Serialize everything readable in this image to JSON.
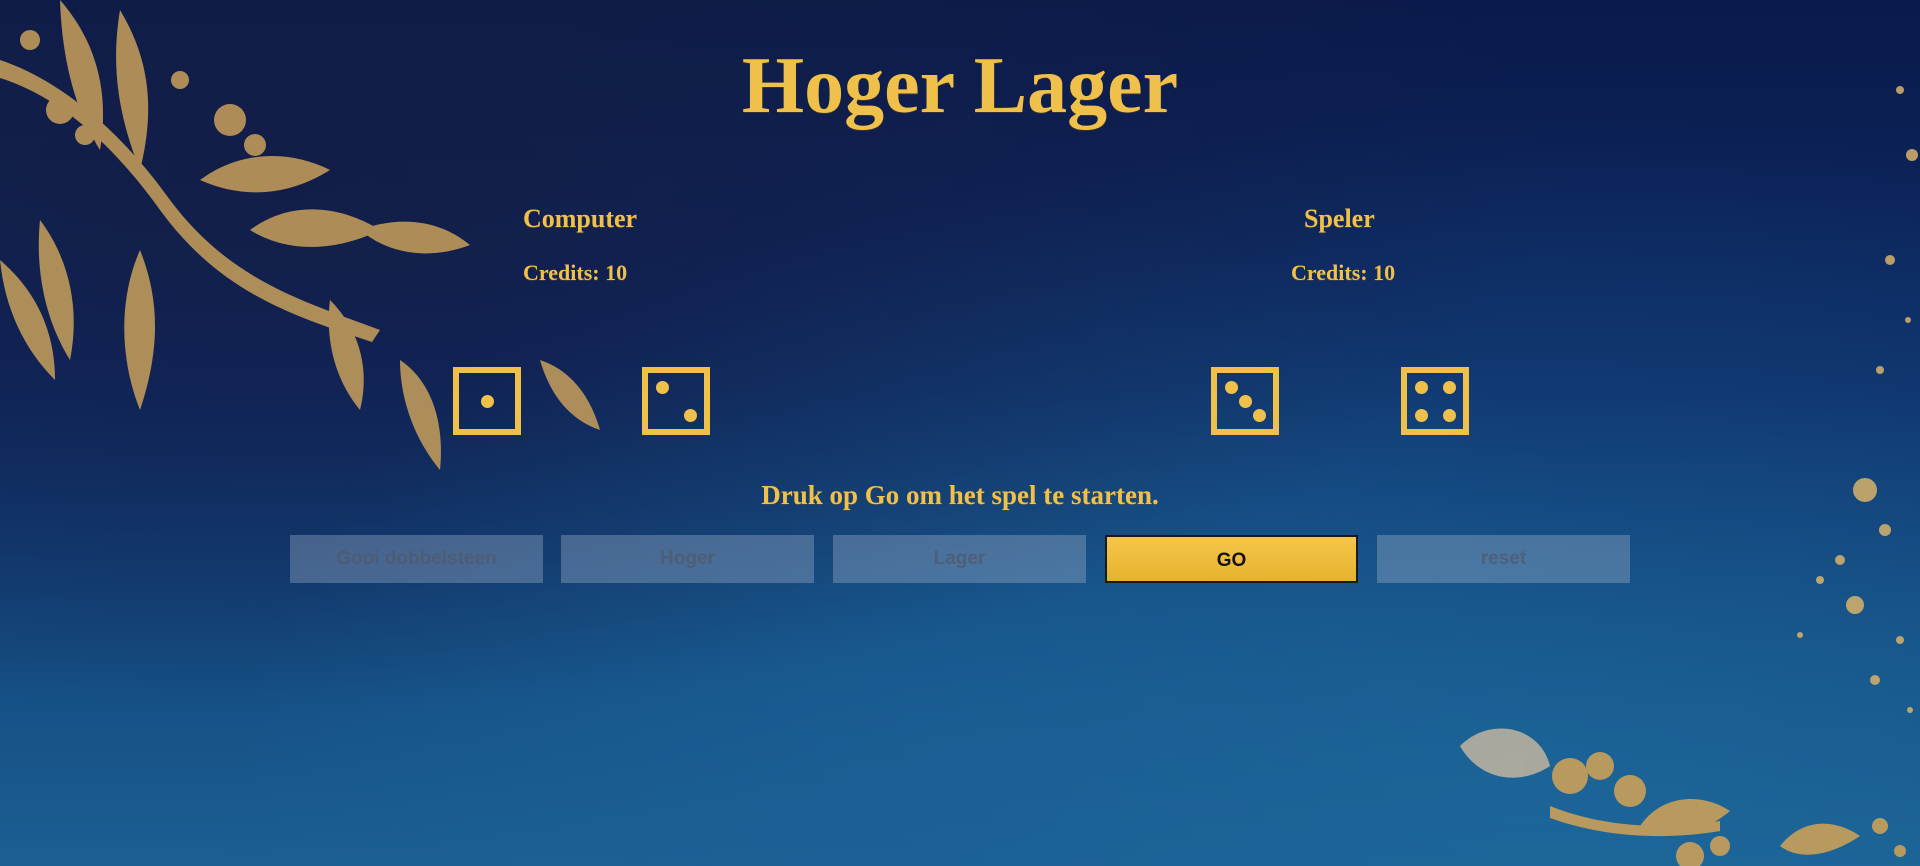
{
  "title": "Hoger Lager",
  "computer": {
    "name": "Computer",
    "credits": "Credits: 10",
    "dice": [
      1,
      2
    ]
  },
  "speler": {
    "name": "Speler",
    "credits": "Credits: 10",
    "dice": [
      3,
      4
    ]
  },
  "message": "Druk op Go om het spel te starten.",
  "buttons": {
    "gooi": "Gooi dobbelsteen",
    "hoger": "Hoger",
    "lager": "Lager",
    "go": "GO",
    "reset": "reset"
  },
  "colors": {
    "gold": "#f0c14a",
    "background": "#0d2a66",
    "button_disabled": "#aab9d2"
  }
}
